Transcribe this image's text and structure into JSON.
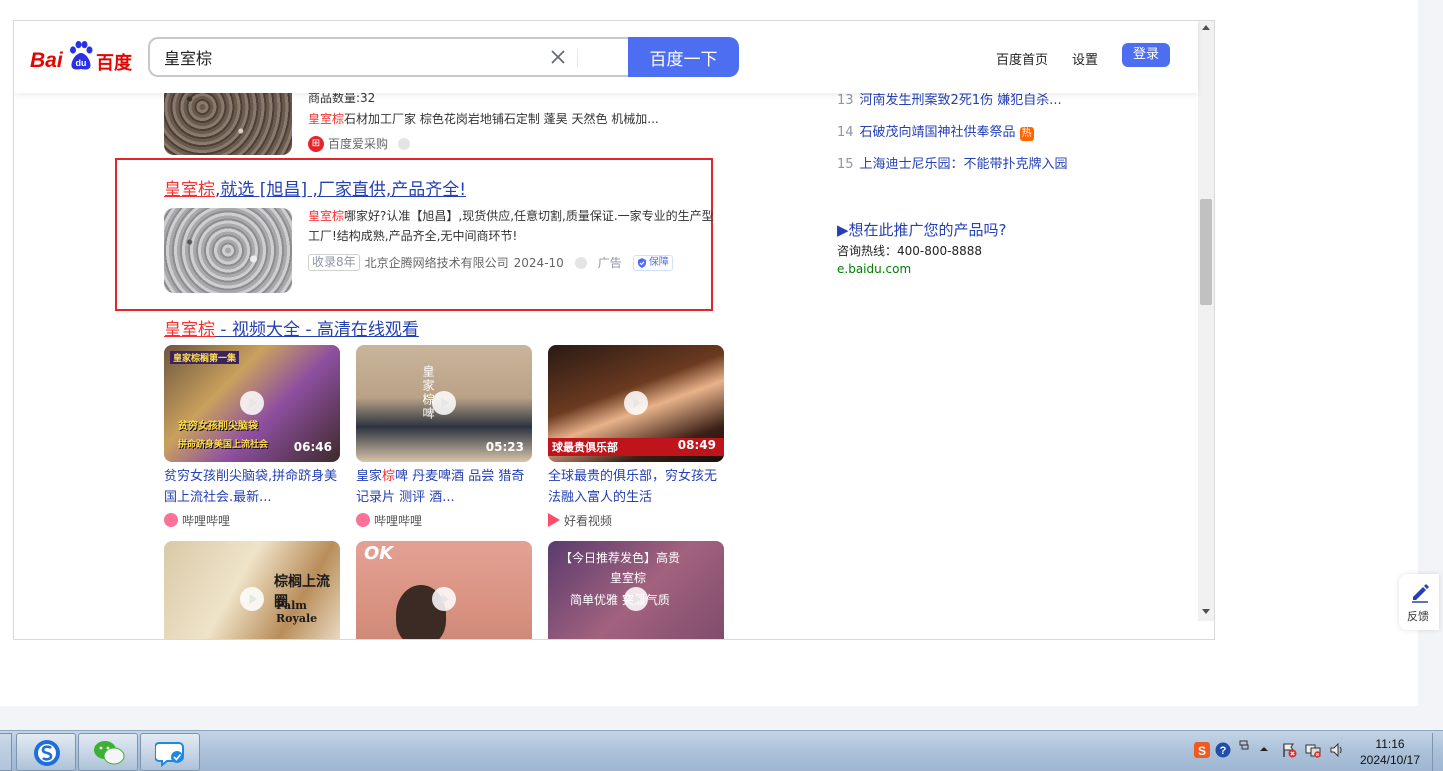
{
  "header": {
    "logo_text_en": "Bai",
    "logo_text_paw": "du",
    "logo_text_cn": "百度",
    "search_value": "皇室棕",
    "search_button": "百度一下",
    "nav_home": "百度首页",
    "nav_settings": "设置",
    "login": "登录"
  },
  "result1": {
    "product_count": "商品数量:32",
    "desc_highlight": "皇室棕",
    "desc_rest": "石材加工厂家 棕色花岗岩地铺石定制 蓬昊 天然色 机械加...",
    "source": "百度爱采购",
    "source_icon": "cart-icon"
  },
  "ad": {
    "title_highlight": "皇室棕",
    "title_rest": ",就选 [旭昌] ,厂家直供,产品齐全!",
    "desc_highlight": "皇室棕",
    "desc_rest": "哪家好?认准【旭昌】,现货供应,任意切割,质量保证.一家专业的生产型工厂!结构成熟,产品齐全,无中间商环节!",
    "tag": "收录8年",
    "company": "北京企腾网络技术有限公司",
    "date": "2024-10",
    "ad_label": "广告",
    "badge": "保障"
  },
  "video_section": {
    "title_highlight": "皇室棕",
    "title_rest": " - 视频大全 - 高清在线观看",
    "videos": [
      {
        "overlay_top": "皇家棕榈第一集",
        "overlay_bottom": "贫穷女孩削尖脑袋",
        "overlay_bottom2": "拼命跻身美国上流社会",
        "duration": "06:46",
        "title": "贫穷女孩削尖脑袋,拼命跻身美国上流社会.最新...",
        "source": "哔哩哔哩"
      },
      {
        "overlay_top": "皇家棕啤",
        "overlay_bottom": "",
        "overlay_bottom2": "",
        "duration": "05:23",
        "title_pre": "皇家",
        "title_highlight": "棕",
        "title_rest": "啤 丹麦啤酒 品尝 猎奇记录片 测评 酒...",
        "source": "哔哩哔哩"
      },
      {
        "overlay_top": "",
        "overlay_bottom": "球最贵俱乐部",
        "overlay_bottom2": "",
        "duration": "08:49",
        "title": "全球最贵的俱乐部，穷女孩无法融入富人的生活",
        "source": "好看视频"
      },
      {
        "overlay_top": "棕榈上流圈",
        "overlay_bottom": "Palm Royale",
        "overlay_bottom2": "",
        "duration": "",
        "title": "",
        "source": ""
      },
      {
        "overlay_top": "OK",
        "overlay_bottom": "",
        "overlay_bottom2": "",
        "duration": "",
        "title": "",
        "source": ""
      },
      {
        "overlay_top": "【今日推荐发色】高贵",
        "overlay_bottom": "皇室棕",
        "overlay_bottom2": "简单优雅 突显气质",
        "duration": "",
        "title": "",
        "source": ""
      }
    ]
  },
  "hot_list": [
    {
      "num": "13",
      "text": "河南发生刑案致2死1伤 嫌犯自杀..."
    },
    {
      "num": "14",
      "text": "石破茂向靖国神社供奉祭品",
      "badge": "热"
    },
    {
      "num": "15",
      "text": "上海迪士尼乐园：不能带扑克牌入园"
    }
  ],
  "promo": {
    "title": "▶想在此推广您的产品吗?",
    "hotline": "咨询热线：400-800-8888",
    "url": "e.baidu.com"
  },
  "feedback": "反馈",
  "taskbar": {
    "time": "11:16",
    "date": "2024/10/17"
  },
  "colors": {
    "brand_blue": "#4e6ef2",
    "brand_red": "#e10602",
    "link_blue": "#2440b3",
    "highlight_red": "#f73131",
    "ad_border": "#e4262c"
  }
}
